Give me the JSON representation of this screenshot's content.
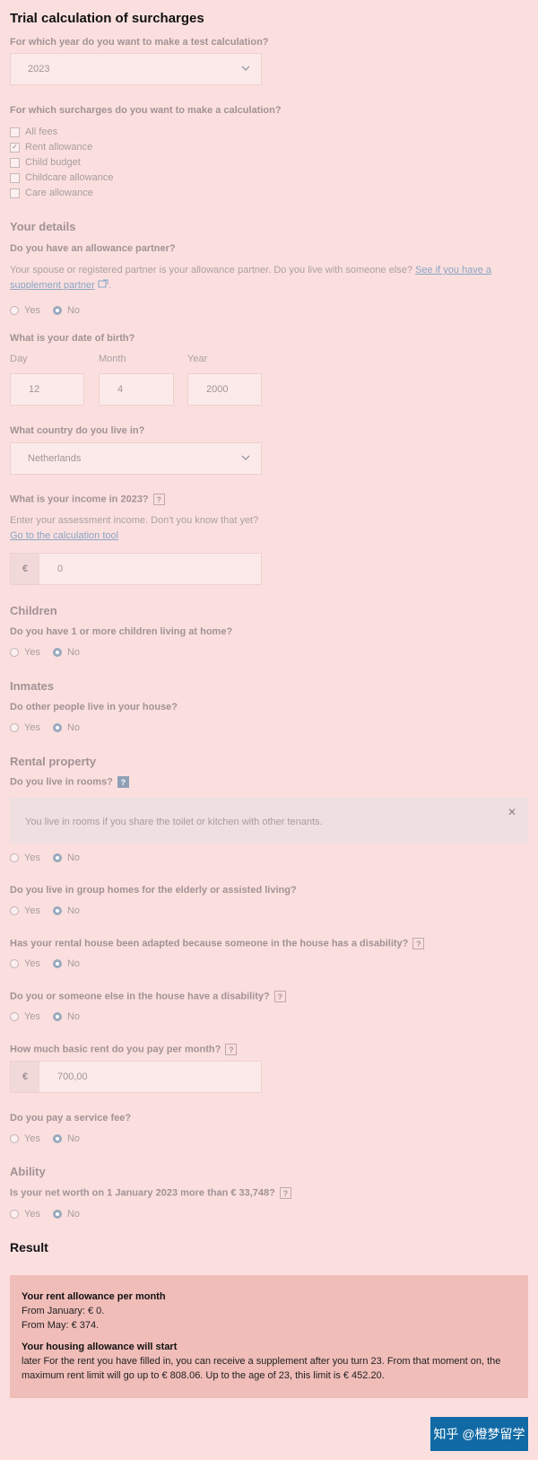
{
  "title": "Trial calculation of surcharges",
  "year_q": "For which year do you want to make a test calculation?",
  "year_value": "2023",
  "surcharges_q": "For which surcharges do you want to make a calculation?",
  "surcharges": [
    {
      "label": "All fees",
      "checked": false
    },
    {
      "label": "Rent allowance",
      "checked": true
    },
    {
      "label": "Child budget",
      "checked": false
    },
    {
      "label": "Childcare allowance",
      "checked": false
    },
    {
      "label": "Care allowance",
      "checked": false
    }
  ],
  "details": {
    "heading": "Your details",
    "partner_q": "Do you have an allowance partner?",
    "partner_text": "Your spouse or registered partner is your allowance partner. Do you live with someone else?",
    "partner_link_1": "See if you have a",
    "partner_link_2": "supplement partner",
    "yes": "Yes",
    "no": "No"
  },
  "dob": {
    "q": "What is your date of birth?",
    "day_label": "Day",
    "month_label": "Month",
    "year_label": "Year",
    "day": "12",
    "month": "4",
    "year": "2000"
  },
  "country": {
    "q": "What country do you live in?",
    "value": "Netherlands"
  },
  "income": {
    "q": "What is your income in 2023?",
    "hint": "Enter your assessment income. Don't you know that yet?",
    "link": "Go to the calculation tool",
    "currency": "€",
    "value": "0"
  },
  "children": {
    "heading": "Children",
    "q": "Do you have 1 or more children living at home?"
  },
  "inmates": {
    "heading": "Inmates",
    "q": "Do other people live in your house?"
  },
  "rental": {
    "heading": "Rental property",
    "rooms_q": "Do you live in rooms?",
    "rooms_info": "You live in rooms if you share the toilet or kitchen with other tenants.",
    "group_q": "Do you live in group homes for the elderly or assisted living?",
    "adapted_q": "Has your rental house been adapted because someone in the house has a disability?",
    "disability_q": "Do you or someone else in the house have a disability?",
    "rent_q": "How much basic rent do you pay per month?",
    "rent_currency": "€",
    "rent_value": "700,00",
    "service_q": "Do you pay a service fee?"
  },
  "ability": {
    "heading": "Ability",
    "q": "Is your net worth on 1 January 2023 more than € 33,748?"
  },
  "result": {
    "heading": "Result",
    "box_title": "Your rent allowance per month",
    "line1": "From January: € 0.",
    "line2": "From May: € 374.",
    "start_title": "Your housing allowance will start",
    "start_text": "later For the rent you have filled in, you can receive a supplement after you turn 23. From that moment on, the maximum rent limit will go up to € 808.06. Up to the age of 23, this limit is € 452.20."
  },
  "help_symbol": "?",
  "close_symbol": "✕",
  "watermark": "知乎 @橙梦留学"
}
